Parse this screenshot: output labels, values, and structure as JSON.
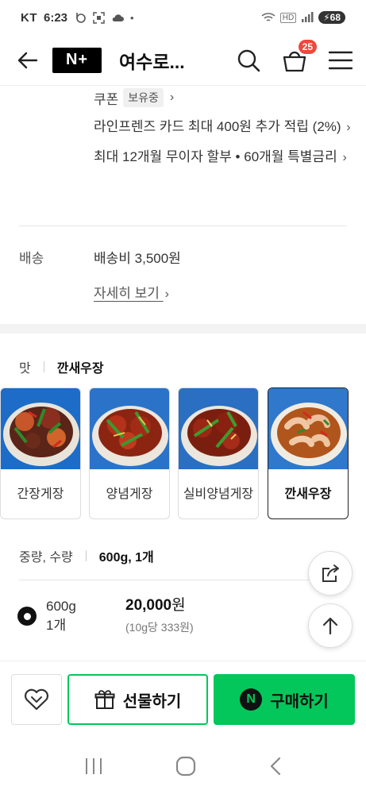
{
  "status_bar": {
    "carrier": "KT",
    "time": "6:23",
    "battery": "68",
    "network": "HD"
  },
  "header": {
    "logo": "N+",
    "store_name": "여수로...",
    "cart_count": "25"
  },
  "benefits": {
    "coupon_label": "쿠폰",
    "coupon_badge": "보유중",
    "card_reward": "라인프렌즈 카드 최대 400원 추가 적립 (2%)",
    "installment": "최대 12개월 무이자 할부 • 60개월 특별금리"
  },
  "shipping": {
    "label": "배송",
    "value": "배송비 3,500원",
    "more": "자세히 보기"
  },
  "taste": {
    "label": "맛",
    "selected": "깐새우장"
  },
  "options": [
    {
      "name": "간장게장",
      "selected": false
    },
    {
      "name": "양념게장",
      "selected": false
    },
    {
      "name": "실비양념게장",
      "selected": false
    },
    {
      "name": "깐새우장",
      "selected": true
    }
  ],
  "weight": {
    "label": "중량, 수량",
    "value": "600g, 1개"
  },
  "selected_option": {
    "name_line1": "600g",
    "name_line2": "1개",
    "price_number": "20,000",
    "price_unit": "원",
    "unit_price": "(10g당 333원)"
  },
  "bottom_bar": {
    "gift_label": "선물하기",
    "buy_label": "구매하기",
    "buy_icon": "N"
  },
  "colors": {
    "accent_green": "#03c75a",
    "badge_red": "#f0473c"
  }
}
